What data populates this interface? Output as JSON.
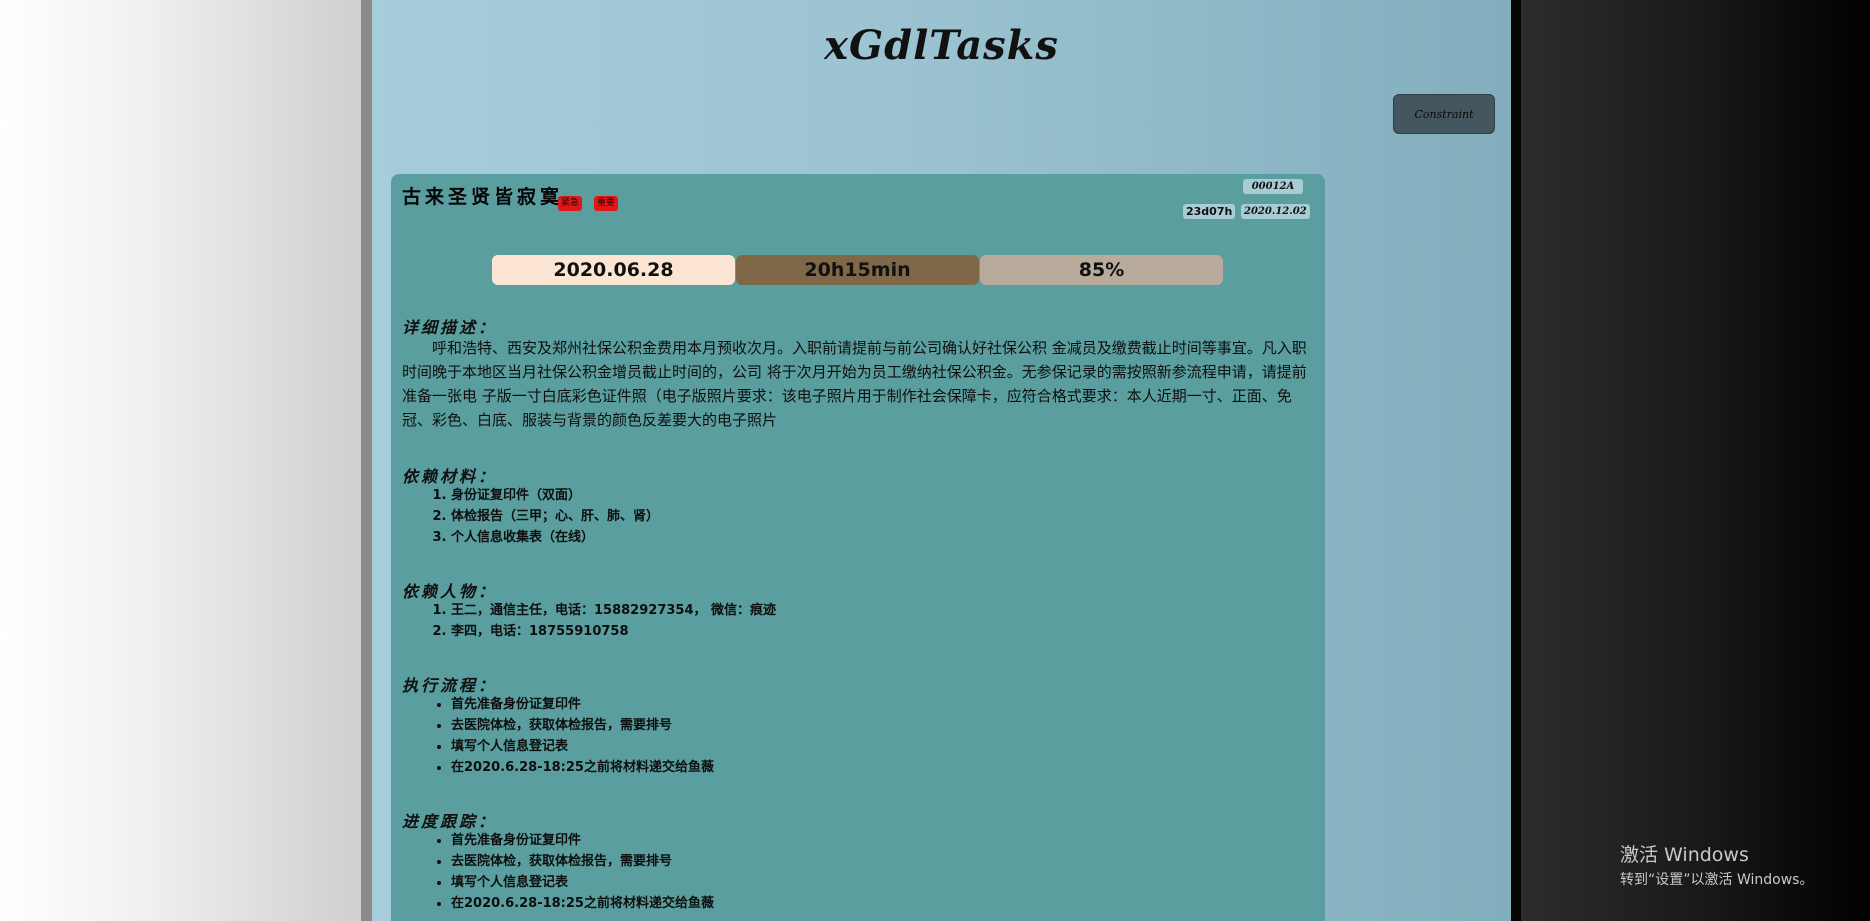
{
  "app": {
    "title": "xGdlTasks",
    "constraint_label": "Constraint"
  },
  "task": {
    "title": "古来圣贤皆寂寞",
    "tags": [
      "紧急",
      "重要"
    ],
    "id": "00012A",
    "remaining": "23d07h",
    "created": "2020.12.02",
    "stats": {
      "date": "2020.06.28",
      "duration": "20h15min",
      "progress": "85%"
    },
    "description_heading": "详细描述：",
    "description": "呼和浩特、西安及郑州社保公积金费用本月预收次月。入职前请提前与前公司确认好社保公积 金减员及缴费截止时间等事宜。凡入职时间晚于本地区当月社保公积金增员截止时间的，公司 将于次月开始为员工缴纳社保公积金。无参保记录的需按照新参流程申请，请提前准备一张电 子版一寸白底彩色证件照（电子版照片要求：该电子照片用于制作社会保障卡，应符合格式要求：本人近期一寸、正面、免冠、彩色、白底、服装与背景的颜色反差要大的电子照片",
    "materials_heading": "依赖材料：",
    "materials": [
      "身份证复印件（双面）",
      "体检报告（三甲；心、肝、肺、肾）",
      "个人信息收集表（在线）"
    ],
    "people_heading": "依赖人物：",
    "people": [
      "王二，通信主任，电话：15882927354， 微信：痕迹",
      "李四，电话：18755910758"
    ],
    "process_heading": "执行流程：",
    "process": [
      "首先准备身份证复印件",
      "去医院体检，获取体检报告，需要排号",
      "填写个人信息登记表",
      "在2020.6.28-18:25之前将材料递交给鱼薇"
    ],
    "tracking_heading": "进度跟踪：",
    "tracking": [
      "首先准备身份证复印件",
      "去医院体检，获取体检报告，需要排号",
      "填写个人信息登记表",
      "在2020.6.28-18:25之前将材料递交给鱼薇"
    ]
  },
  "os_watermark": {
    "line1": "激活 Windows",
    "line2": "转到“设置”以激活 Windows。"
  },
  "colors": {
    "card_bg": "#5a9e9f",
    "date_chip": "#fce6d3",
    "duration_chip": "#7f6848",
    "progress_chip": "#b9ab9b",
    "tag_bg": "#e01818",
    "constraint_btn": "#45575e"
  }
}
